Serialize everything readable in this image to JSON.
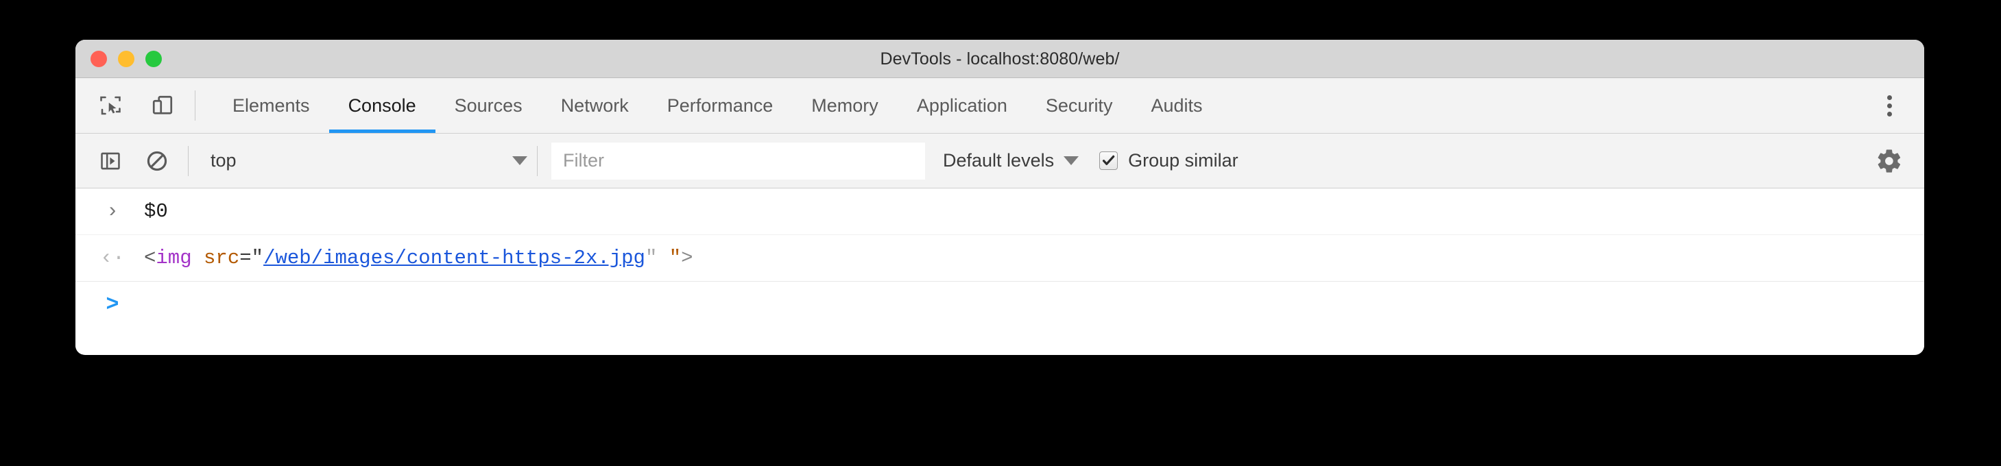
{
  "window": {
    "title": "DevTools - localhost:8080/web/",
    "traffic_lights": [
      {
        "name": "close",
        "color": "#ff6155"
      },
      {
        "name": "minimize",
        "color": "#ffbd2e"
      },
      {
        "name": "maximize",
        "color": "#27c93f"
      }
    ]
  },
  "tabbar": {
    "left_icons": [
      {
        "name": "inspect-element-icon",
        "label": "Inspect element"
      },
      {
        "name": "device-toolbar-icon",
        "label": "Toggle device toolbar"
      }
    ],
    "tabs": [
      {
        "label": "Elements",
        "active": false
      },
      {
        "label": "Console",
        "active": true
      },
      {
        "label": "Sources",
        "active": false
      },
      {
        "label": "Network",
        "active": false
      },
      {
        "label": "Performance",
        "active": false
      },
      {
        "label": "Memory",
        "active": false
      },
      {
        "label": "Application",
        "active": false
      },
      {
        "label": "Security",
        "active": false
      },
      {
        "label": "Audits",
        "active": false
      }
    ],
    "more_menu": "more-options-icon",
    "active_underline_color": "#2196f3"
  },
  "console_toolbar": {
    "sidebar_toggle": "console-sidebar-toggle-icon",
    "clear_console": "clear-console-icon",
    "context": {
      "value": "top",
      "caret": "chevron-down-icon"
    },
    "filter": {
      "value": "",
      "placeholder": "Filter"
    },
    "levels": {
      "label": "Default levels",
      "caret": "chevron-down-icon"
    },
    "group_similar": {
      "label": "Group similar",
      "checked": true
    },
    "settings": "gear-icon"
  },
  "console": {
    "messages": [
      {
        "kind": "input",
        "gutter": "›",
        "text": "$0"
      },
      {
        "kind": "result",
        "gutter": "‹·",
        "tokens": {
          "open": "<",
          "tag": "img",
          "space": " ",
          "attr": "src",
          "eq": "=\"",
          "link": "/web/images/content-https-2x.jpg",
          "quote_close_light": "\"",
          "gap": " ",
          "quote_orphan": "\"",
          "close": ">"
        },
        "full_text": "<img src=\"/web/images/content-https-2x.jpg\" \">"
      }
    ],
    "prompt": {
      "caret": ">",
      "value": ""
    }
  }
}
